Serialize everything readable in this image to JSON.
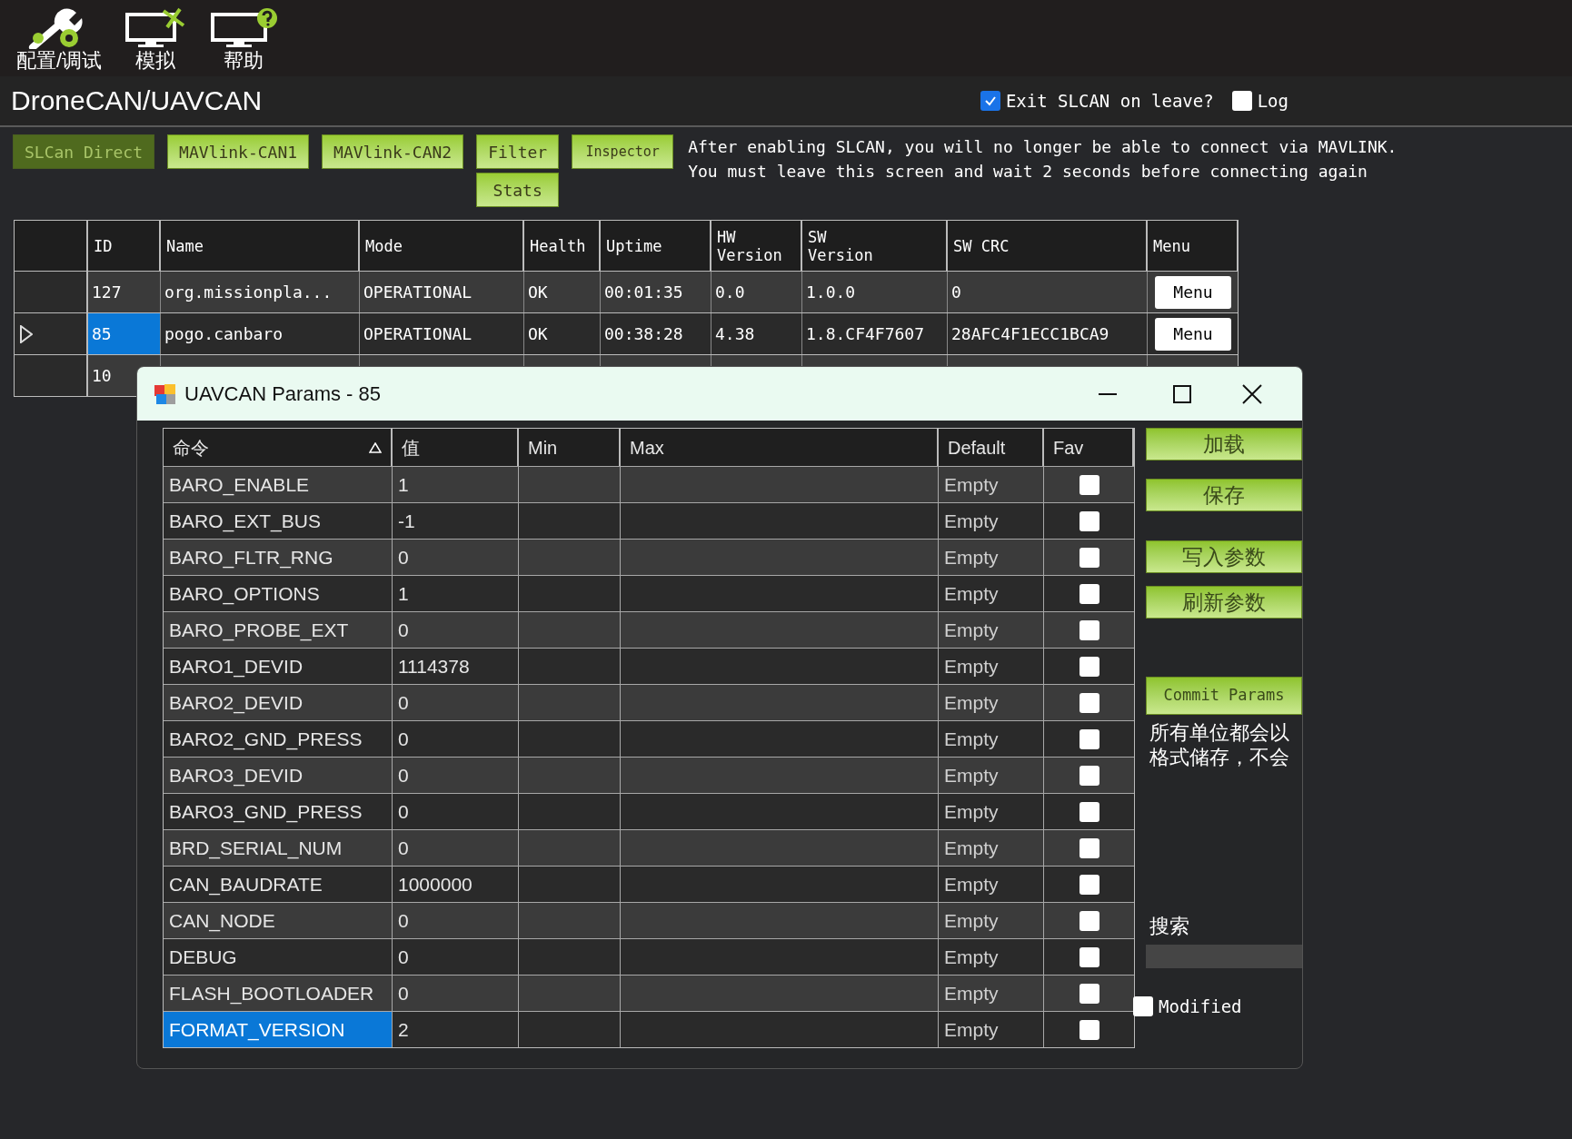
{
  "toolbar": [
    {
      "label": "配置/调试",
      "kind": "config"
    },
    {
      "label": "模拟",
      "kind": "simulation"
    },
    {
      "label": "帮助",
      "kind": "help"
    }
  ],
  "page_title": "DroneCAN/UAVCAN",
  "options": [
    {
      "label": "Exit SLCAN on leave?",
      "checked": true
    },
    {
      "label": "Log",
      "checked": false
    }
  ],
  "buttons": [
    {
      "label": "SLCan Direct",
      "disabled": true
    },
    {
      "label": "MAVlink-CAN1",
      "disabled": false
    },
    {
      "label": "MAVlink-CAN2",
      "disabled": false
    }
  ],
  "filter_button": "Filter",
  "stats_button": "Stats",
  "inspector_button": "Inspector",
  "info": [
    "After enabling SLCAN, you will no longer be able to connect via MAVLINK.",
    "You must leave this screen and wait 2 seconds before connecting again"
  ],
  "nodes": {
    "columns": [
      "ID",
      "Name",
      "Mode",
      "Health",
      "Uptime",
      "HW Version",
      "SW Version",
      "SW CRC",
      "Menu"
    ],
    "rows": [
      {
        "selected": false,
        "cells": [
          "127",
          "org.missionpla...",
          "OPERATIONAL",
          "OK",
          "00:01:35",
          "0.0",
          "1.0.0",
          "0"
        ],
        "menu": "Menu"
      },
      {
        "selected": true,
        "cells": [
          "85",
          "pogo.canbaro",
          "OPERATIONAL",
          "OK",
          "00:38:28",
          "4.38",
          "1.8.CF4F7607",
          "28AFC4F1ECC1BCA9"
        ],
        "menu": "Menu"
      },
      {
        "selected": false,
        "cells": [
          "10"
        ]
      }
    ]
  },
  "dialog": {
    "title": "UAVCAN Params - 85",
    "columns": [
      "命令",
      "值",
      "Min",
      "Max",
      "Default",
      "Fav"
    ],
    "rows": [
      {
        "name": "BARO_ENABLE",
        "value": "1",
        "default": "Empty",
        "fav": false,
        "selected": false
      },
      {
        "name": "BARO_EXT_BUS",
        "value": "-1",
        "default": "Empty",
        "fav": false,
        "selected": false
      },
      {
        "name": "BARO_FLTR_RNG",
        "value": "0",
        "default": "Empty",
        "fav": false,
        "selected": false
      },
      {
        "name": "BARO_OPTIONS",
        "value": "1",
        "default": "Empty",
        "fav": false,
        "selected": false
      },
      {
        "name": "BARO_PROBE_EXT",
        "value": "0",
        "default": "Empty",
        "fav": false,
        "selected": false
      },
      {
        "name": "BARO1_DEVID",
        "value": "1114378",
        "default": "Empty",
        "fav": false,
        "selected": false
      },
      {
        "name": "BARO2_DEVID",
        "value": "0",
        "default": "Empty",
        "fav": false,
        "selected": false
      },
      {
        "name": "BARO2_GND_PRESS",
        "value": "0",
        "default": "Empty",
        "fav": false,
        "selected": false
      },
      {
        "name": "BARO3_DEVID",
        "value": "0",
        "default": "Empty",
        "fav": false,
        "selected": false
      },
      {
        "name": "BARO3_GND_PRESS",
        "value": "0",
        "default": "Empty",
        "fav": false,
        "selected": false
      },
      {
        "name": "BRD_SERIAL_NUM",
        "value": "0",
        "default": "Empty",
        "fav": false,
        "selected": false
      },
      {
        "name": "CAN_BAUDRATE",
        "value": "1000000",
        "default": "Empty",
        "fav": false,
        "selected": false
      },
      {
        "name": "CAN_NODE",
        "value": "0",
        "default": "Empty",
        "fav": false,
        "selected": false
      },
      {
        "name": "DEBUG",
        "value": "0",
        "default": "Empty",
        "fav": false,
        "selected": false
      },
      {
        "name": "FLASH_BOOTLOADER",
        "value": "0",
        "default": "Empty",
        "fav": false,
        "selected": false
      },
      {
        "name": "FORMAT_VERSION",
        "value": "2",
        "default": "Empty",
        "fav": false,
        "selected": true
      }
    ],
    "side_buttons": [
      "加载",
      "保存",
      "写入参数",
      "刷新参数"
    ],
    "commit_button": "Commit Params",
    "note_lines": [
      "所有单位都会以",
      "格式储存，不会"
    ],
    "search_label": "搜索",
    "modified": {
      "label": "Modified",
      "checked": false
    }
  }
}
